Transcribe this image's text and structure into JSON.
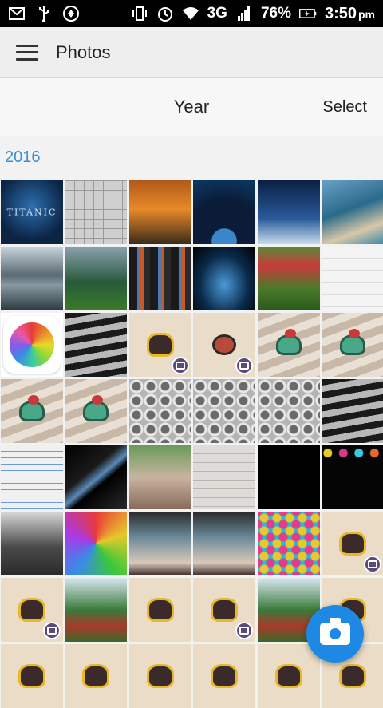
{
  "status_bar": {
    "battery_percent": "76%",
    "network": "3G",
    "time": "3:50",
    "ampm": "pm",
    "icons": [
      "gmail-icon",
      "usb-icon",
      "sync-icon",
      "vibrate-icon",
      "alarm-icon",
      "wifi-icon",
      "signal-icon",
      "battery-charging-icon"
    ]
  },
  "app_bar": {
    "title": "Photos",
    "menu_icon": "hamburger-menu-icon"
  },
  "subbar": {
    "view_label": "Year",
    "select_label": "Select"
  },
  "section": {
    "year": "2016"
  },
  "thumbnail_text": {
    "titanic": "TITANIC"
  },
  "colors": {
    "accent": "#3a8fd6",
    "fab": "#1e88e5"
  },
  "fab": {
    "icon": "camera-icon"
  }
}
